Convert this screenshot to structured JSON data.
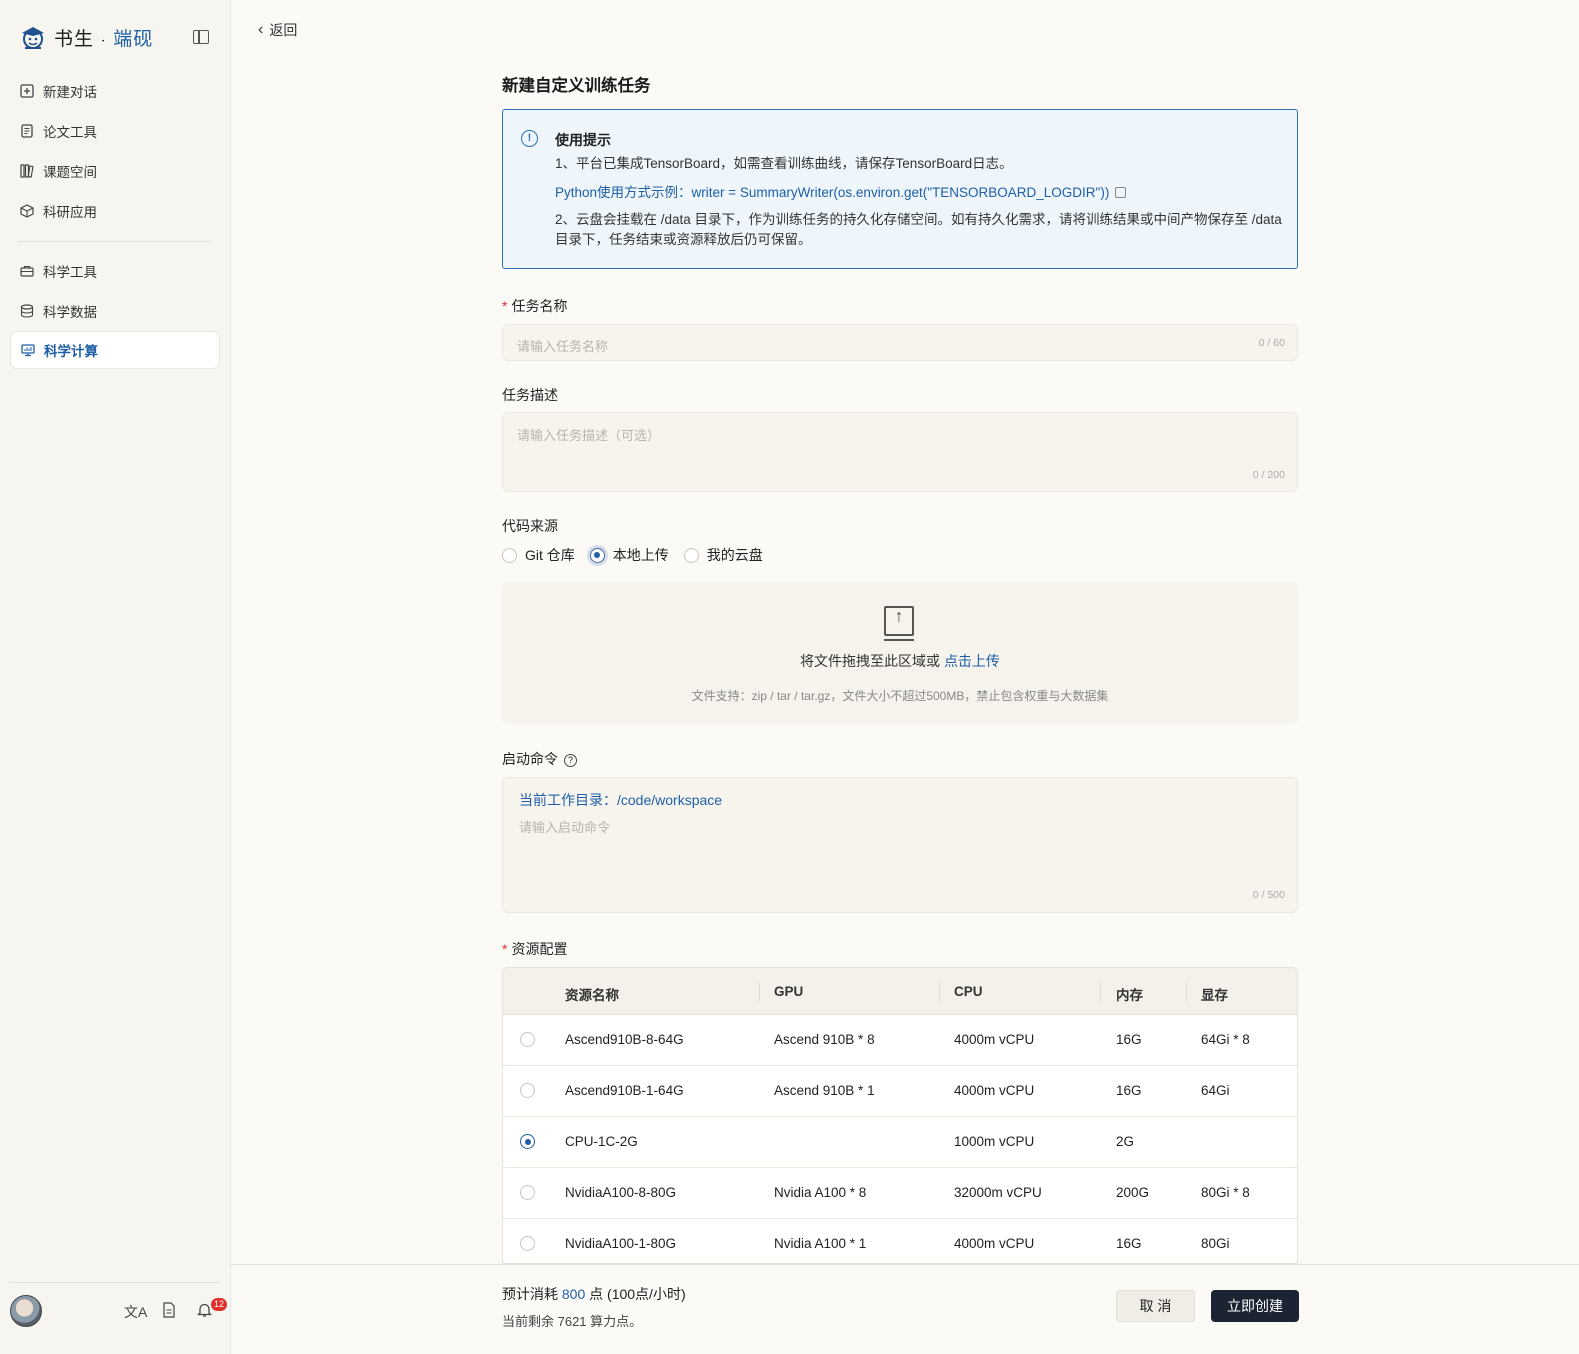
{
  "brand": {
    "name_main": "书生",
    "name_dot": "·",
    "name_accent": "端砚"
  },
  "sidebar": {
    "items": [
      {
        "label": "新建对话",
        "icon": "plus-square-icon"
      },
      {
        "label": "论文工具",
        "icon": "document-icon"
      },
      {
        "label": "课题空间",
        "icon": "books-icon"
      },
      {
        "label": "科研应用",
        "icon": "cube-icon"
      },
      {
        "label": "科学工具",
        "icon": "toolbox-icon"
      },
      {
        "label": "科学数据",
        "icon": "database-icon"
      },
      {
        "label": "科学计算",
        "icon": "monitor-icon"
      }
    ],
    "footer": {
      "translate_icon_text": "文A",
      "notification_count": "12"
    }
  },
  "header": {
    "back_label": "返回"
  },
  "form": {
    "title": "新建自定义训练任务",
    "tips": {
      "title": "使用提示",
      "line1": "1、平台已集成TensorBoard，如需查看训练曲线，请保存TensorBoard日志。",
      "code": "Python使用方式示例：writer = SummaryWriter(os.environ.get(\"TENSORBOARD_LOGDIR\"))",
      "line2": "2、云盘会挂载在 /data 目录下，作为训练任务的持久化存储空间。如有持久化需求，请将训练结果或中间产物保存至 /data 目录下，任务结束或资源释放后仍可保留。"
    },
    "task_name": {
      "label": "任务名称",
      "placeholder": "请输入任务名称",
      "counter": "0 / 60"
    },
    "task_desc": {
      "label": "任务描述",
      "placeholder": "请输入任务描述（可选）",
      "counter": "0 / 200"
    },
    "code_source": {
      "label": "代码来源",
      "options": [
        "Git 仓库",
        "本地上传",
        "我的云盘"
      ],
      "selected": "本地上传"
    },
    "upload": {
      "text": "将文件拖拽至此区域或",
      "link": "点击上传",
      "hint": "文件支持：zip / tar / tar.gz，文件大小不超过500MB，禁止包含权重与大数据集"
    },
    "start_cmd": {
      "label": "启动命令",
      "workdir": "当前工作目录：/code/workspace",
      "placeholder": "请输入启动命令",
      "counter": "0 / 500"
    },
    "resources": {
      "label": "资源配置",
      "columns": [
        "资源名称",
        "GPU",
        "CPU",
        "内存",
        "显存"
      ],
      "rows": [
        {
          "name": "Ascend910B-8-64G",
          "gpu": "Ascend 910B * 8",
          "cpu": "4000m vCPU",
          "mem": "16G",
          "vram": "64Gi * 8",
          "selected": false
        },
        {
          "name": "Ascend910B-1-64G",
          "gpu": "Ascend 910B * 1",
          "cpu": "4000m vCPU",
          "mem": "16G",
          "vram": "64Gi",
          "selected": false
        },
        {
          "name": "CPU-1C-2G",
          "gpu": "",
          "cpu": "1000m vCPU",
          "mem": "2G",
          "vram": "",
          "selected": true
        },
        {
          "name": "NvidiaA100-8-80G",
          "gpu": "Nvidia A100 * 8",
          "cpu": "32000m vCPU",
          "mem": "200G",
          "vram": "80Gi * 8",
          "selected": false
        },
        {
          "name": "NvidiaA100-1-80G",
          "gpu": "Nvidia A100 * 1",
          "cpu": "4000m vCPU",
          "mem": "16G",
          "vram": "80Gi",
          "selected": false
        }
      ]
    }
  },
  "footer": {
    "cost_prefix": "预计消耗",
    "cost_value": "800",
    "cost_suffix": "点 (100点/小时)",
    "remain": "当前剩余 7621 算力点。",
    "cancel_label": "取 消",
    "create_label": "立即创建"
  },
  "colors": {
    "accent": "#1e5fa8",
    "primary_button": "#1c2434",
    "danger": "#e0302b"
  }
}
